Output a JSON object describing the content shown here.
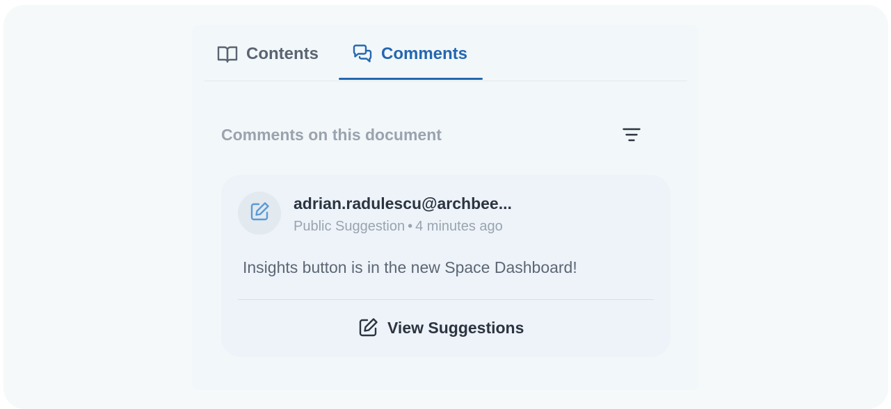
{
  "tabs": [
    {
      "label": "Contents",
      "icon": "book-open-icon",
      "active": false
    },
    {
      "label": "Comments",
      "icon": "chat-bubbles-icon",
      "active": true
    }
  ],
  "comments": {
    "title": "Comments on this document",
    "filter_icon": "filter-lines-icon",
    "items": [
      {
        "author": "adrian.radulescu@archbee...",
        "type": "Public Suggestion",
        "separator": "•",
        "time": "4 minutes ago",
        "text": "Insights button is in the new Space Dashboard!",
        "avatar_icon": "edit-square-icon",
        "action_label": "View Suggestions",
        "action_icon": "edit-square-icon"
      }
    ]
  },
  "colors": {
    "accent": "#2467b0",
    "muted_text": "#9aa3ae",
    "card_bg": "#edf3f9"
  }
}
